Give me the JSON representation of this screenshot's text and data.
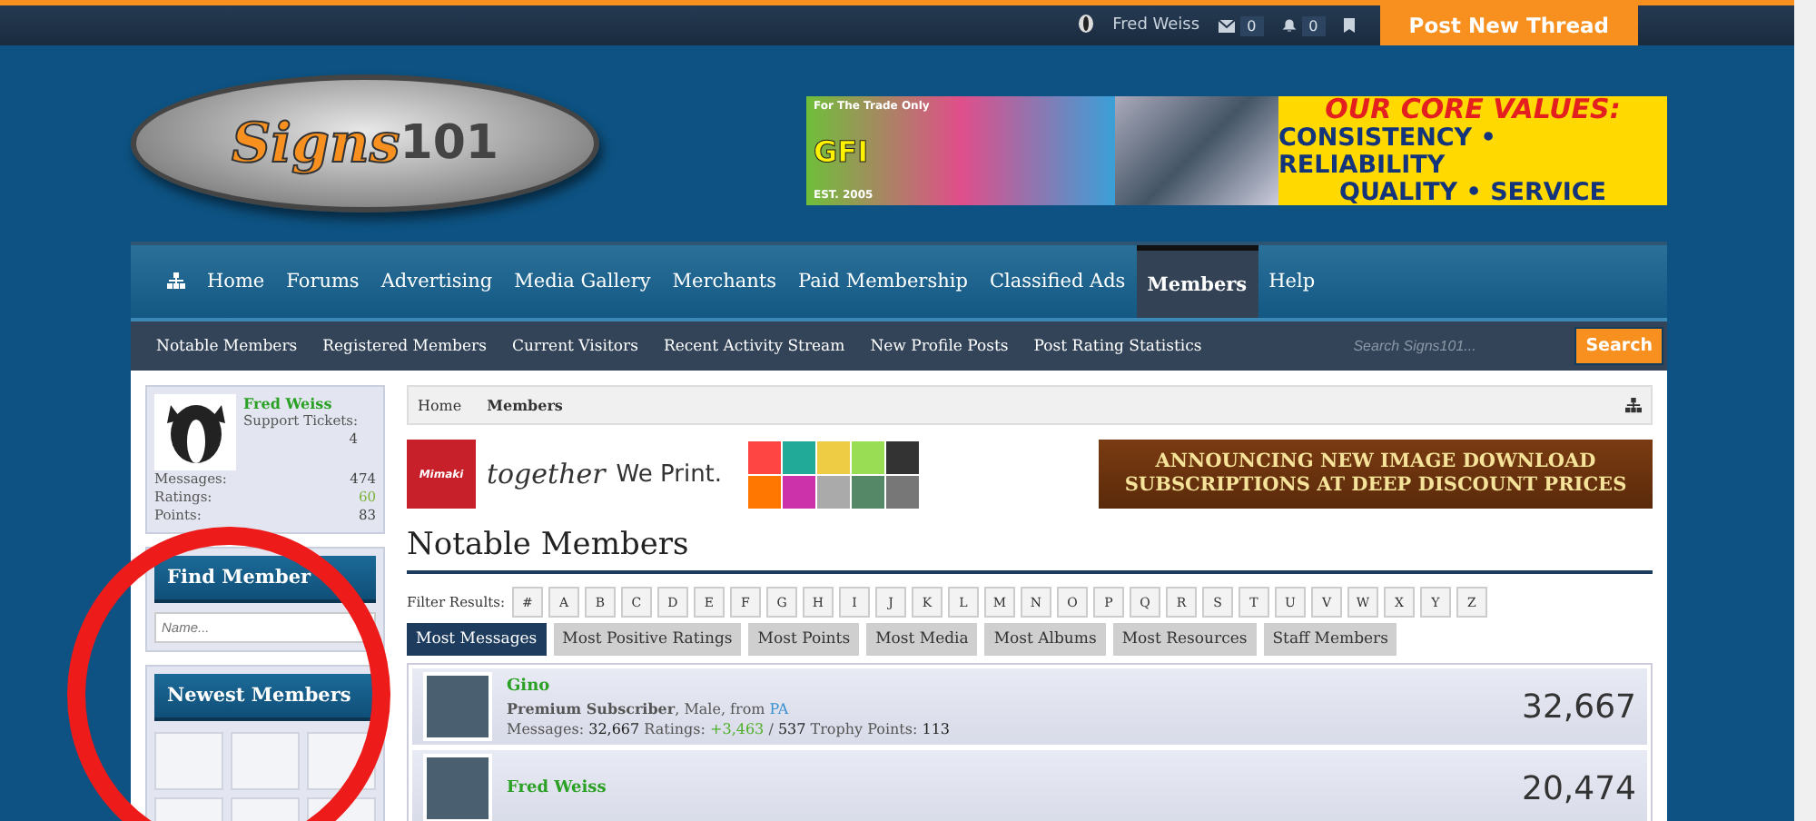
{
  "top_bar": {
    "username": "Fred Weiss",
    "inbox_count": "0",
    "alerts_count": "0",
    "post_button": "Post New Thread"
  },
  "logo": {
    "word": "Signs",
    "number": "101"
  },
  "header_ad": {
    "tag": "For The Trade Only",
    "brand": "GFI",
    "est": "EST. 2005",
    "headline": "OUR CORE VALUES:",
    "line_1": "CONSISTENCY • RELIABILITY",
    "line_2": "QUALITY • SERVICE"
  },
  "nav": {
    "items": [
      {
        "label": "Home",
        "selected": false
      },
      {
        "label": "Forums",
        "selected": false
      },
      {
        "label": "Advertising",
        "selected": false
      },
      {
        "label": "Media Gallery",
        "selected": false
      },
      {
        "label": "Merchants",
        "selected": false
      },
      {
        "label": "Paid Membership",
        "selected": false
      },
      {
        "label": "Classified Ads",
        "selected": false
      },
      {
        "label": "Members",
        "selected": true
      },
      {
        "label": "Help",
        "selected": false
      }
    ]
  },
  "sub_nav": {
    "items": [
      "Notable Members",
      "Registered Members",
      "Current Visitors",
      "Recent Activity Stream",
      "New Profile Posts",
      "Post Rating Statistics"
    ],
    "search_placeholder": "Search Signs101...",
    "search_button": "Search"
  },
  "sidebar": {
    "user": {
      "name": "Fred Weiss",
      "stats": [
        {
          "label": "Support Tickets:",
          "value": "4"
        },
        {
          "label": "Messages:",
          "value": "474"
        },
        {
          "label": "Ratings:",
          "value": "60"
        },
        {
          "label": "Points:",
          "value": "83"
        }
      ]
    },
    "find_member": {
      "title": "Find Member",
      "placeholder": "Name..."
    },
    "newest_members": {
      "title": "Newest Members"
    }
  },
  "breadcrumb": [
    {
      "label": "Home"
    },
    {
      "label": "Members"
    }
  ],
  "ads": {
    "mimaki": {
      "brand": "Mimaki",
      "slogan_script": "together",
      "slogan": "We Print."
    },
    "announcement": {
      "line_1": "ANNOUNCING NEW IMAGE DOWNLOAD",
      "line_2": "SUBSCRIPTIONS AT DEEP DISCOUNT PRICES"
    }
  },
  "page_title": "Notable Members",
  "filter": {
    "label": "Filter Results:",
    "letters": [
      "#",
      "A",
      "B",
      "C",
      "D",
      "E",
      "F",
      "G",
      "H",
      "I",
      "J",
      "K",
      "L",
      "M",
      "N",
      "O",
      "P",
      "Q",
      "R",
      "S",
      "T",
      "U",
      "V",
      "W",
      "X",
      "Y",
      "Z"
    ]
  },
  "tabs": [
    {
      "label": "Most Messages",
      "selected": true
    },
    {
      "label": "Most Positive Ratings",
      "selected": false
    },
    {
      "label": "Most Points",
      "selected": false
    },
    {
      "label": "Most Media",
      "selected": false
    },
    {
      "label": "Most Albums",
      "selected": false
    },
    {
      "label": "Most Resources",
      "selected": false
    },
    {
      "label": "Staff Members",
      "selected": false
    }
  ],
  "members": [
    {
      "name": "Gino",
      "info": "**Premium Subscriber**, Male, from",
      "location": "PA",
      "stats": [
        {
          "label": "Messages:",
          "value": "32,667",
          "kind": "plain"
        },
        {
          "label": "Ratings:",
          "value": "+3,463",
          "kind": "positive"
        },
        {
          "label": "/",
          "value": "537",
          "kind": "plain"
        },
        {
          "label": "Trophy Points:",
          "value": "113",
          "kind": "plain"
        }
      ],
      "count": "32,667"
    },
    {
      "name": "Fred Weiss",
      "count": "20,474"
    }
  ],
  "annotation": {
    "kind": "red_circle"
  }
}
